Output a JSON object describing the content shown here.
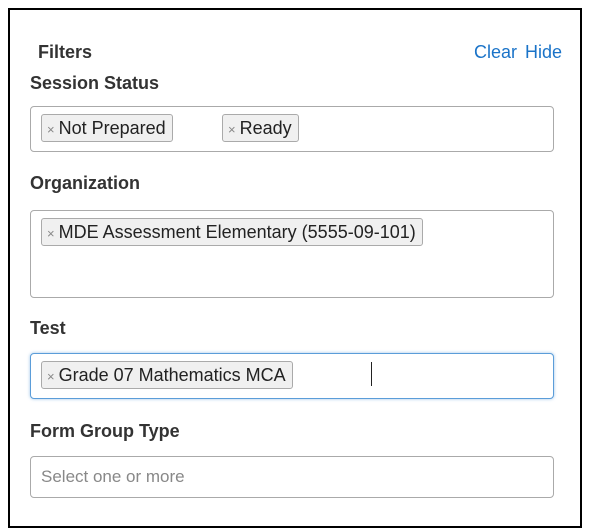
{
  "filters_panel": {
    "title": "Filters",
    "clear_label": "Clear",
    "hide_label": "Hide"
  },
  "session_status": {
    "label": "Session Status",
    "tags": [
      "Not Prepared",
      "Ready"
    ]
  },
  "organization": {
    "label": "Organization",
    "tags": [
      "MDE Assessment Elementary (5555-09-101)"
    ]
  },
  "test": {
    "label": "Test",
    "tags": [
      "Grade 07 Mathematics MCA"
    ]
  },
  "form_group_type": {
    "label": "Form Group Type",
    "placeholder": "Select one or more"
  },
  "icons": {
    "tag_remove": "close-icon",
    "tag_remove_glyph": "×"
  },
  "colors": {
    "link": "#1a73c8",
    "focus_border": "#5b9dd9"
  }
}
